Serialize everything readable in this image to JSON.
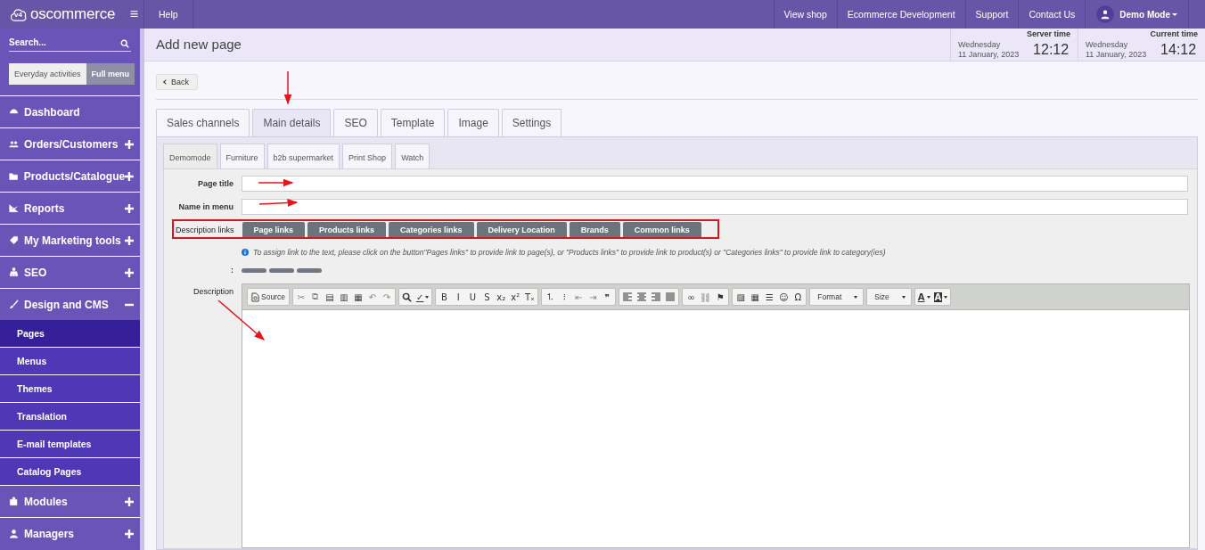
{
  "topbar": {
    "logo": "oscommerce",
    "logo_badge": "v4",
    "menu_glyph": "≡",
    "left_links": [
      "Help"
    ],
    "right_links": [
      "View shop",
      "Ecommerce Development",
      "Support",
      "Contact Us"
    ],
    "user": "Demo Mode"
  },
  "sidebar": {
    "search_placeholder": "Search...",
    "modes": [
      {
        "label": "Everyday activities",
        "selected": false
      },
      {
        "label": "Full menu",
        "selected": true
      }
    ],
    "items": [
      {
        "label": "Dashboard"
      },
      {
        "label": "Orders/Customers",
        "expanded": false
      },
      {
        "label": "Products/Catalogue",
        "expanded": false
      },
      {
        "label": "Reports",
        "expanded": false
      },
      {
        "label": "My Marketing tools",
        "expanded": false
      },
      {
        "label": "SEO",
        "expanded": false
      },
      {
        "label": "Design and CMS",
        "expanded": true,
        "children": [
          {
            "label": "Pages",
            "selected": true
          },
          {
            "label": "Menus",
            "selected": false
          },
          {
            "label": "Themes",
            "selected": false
          },
          {
            "label": "Translation",
            "selected": false
          },
          {
            "label": "E-mail templates",
            "selected": false
          },
          {
            "label": "Catalog Pages",
            "selected": false
          }
        ]
      },
      {
        "label": "Modules",
        "expanded": false
      },
      {
        "label": "Managers",
        "expanded": false
      }
    ]
  },
  "header": {
    "title": "Add new page",
    "clocks": [
      {
        "label": "Server time",
        "day": "Wednesday",
        "date": "11 January, 2023",
        "time": "12:12"
      },
      {
        "label": "Current time",
        "day": "Wednesday",
        "date": "11 January, 2023",
        "time": "14:12"
      }
    ]
  },
  "back_button": "Back",
  "tabs": [
    {
      "label": "Sales channels",
      "selected": false
    },
    {
      "label": "Main details",
      "selected": true
    },
    {
      "label": "SEO",
      "selected": false
    },
    {
      "label": "Template",
      "selected": false
    },
    {
      "label": "Image",
      "selected": false
    },
    {
      "label": "Settings",
      "selected": false
    }
  ],
  "store_tabs": [
    {
      "label": "Demomode",
      "selected": true
    },
    {
      "label": "Furniture",
      "selected": false
    },
    {
      "label": "b2b supermarket",
      "selected": false
    },
    {
      "label": "Print Shop",
      "selected": false
    },
    {
      "label": "Watch",
      "selected": false
    }
  ],
  "form": {
    "page_title_label": "Page title",
    "name_in_menu_label": "Name in menu",
    "links_label": "Description links",
    "link_buttons": [
      "Page links",
      "Products links",
      "Categories links",
      "Delivery Location",
      "Brands",
      "Common links"
    ],
    "info": "To assign link to the text, please click on the button\"Pages links\" to provide link to page(s), or \"Products links\" to provide link to product(s) or \"Categories links\" to provide link to category(ies)",
    "colon_label": ":",
    "description_label": "Description"
  },
  "toolbar": [
    [
      {
        "kind": "source",
        "text": "Source",
        "disabled": false
      }
    ],
    [
      {
        "kind": "glyph",
        "text": "✂",
        "disabled": true
      },
      {
        "kind": "glyph",
        "text": "⧉",
        "disabled": true
      },
      {
        "kind": "glyph",
        "text": "▤",
        "disabled": false
      },
      {
        "kind": "glyph",
        "text": "▥",
        "disabled": false
      },
      {
        "kind": "glyph",
        "text": "▦",
        "disabled": false
      },
      {
        "kind": "glyph",
        "text": "↶",
        "disabled": true
      },
      {
        "kind": "glyph",
        "text": "↷",
        "disabled": true
      }
    ],
    [
      {
        "kind": "search",
        "disabled": false
      },
      {
        "kind": "menu-glyph",
        "text": "✓",
        "disabled": false
      }
    ],
    [
      {
        "kind": "glyph",
        "text": "B",
        "disabled": false
      },
      {
        "kind": "glyph",
        "text": "I",
        "disabled": false
      },
      {
        "kind": "glyph",
        "text": "U",
        "disabled": false
      },
      {
        "kind": "glyph",
        "text": "S",
        "disabled": false
      },
      {
        "kind": "glyph",
        "text": "x₂",
        "disabled": false
      },
      {
        "kind": "glyph",
        "text": "x²",
        "disabled": false
      },
      {
        "kind": "glyph",
        "text": "Tₓ",
        "disabled": false
      }
    ],
    [
      {
        "kind": "glyph",
        "text": "⒈",
        "disabled": false
      },
      {
        "kind": "glyph",
        "text": "⁝",
        "disabled": false
      },
      {
        "kind": "glyph",
        "text": "⇤",
        "disabled": true
      },
      {
        "kind": "glyph",
        "text": "⇥",
        "disabled": true
      },
      {
        "kind": "glyph",
        "text": "❞",
        "disabled": false
      }
    ],
    [
      {
        "kind": "align-left",
        "disabled": false
      },
      {
        "kind": "align-center",
        "disabled": false
      },
      {
        "kind": "align-right",
        "disabled": false
      },
      {
        "kind": "align-justify",
        "disabled": false
      }
    ],
    [
      {
        "kind": "glyph",
        "text": "∞",
        "disabled": false
      },
      {
        "kind": "glyph",
        "text": "⛓",
        "disabled": true
      },
      {
        "kind": "glyph",
        "text": "⚑",
        "disabled": false
      }
    ],
    [
      {
        "kind": "glyph",
        "text": "▨",
        "disabled": false
      },
      {
        "kind": "glyph",
        "text": "▦",
        "disabled": false
      },
      {
        "kind": "glyph",
        "text": "☰",
        "disabled": false
      },
      {
        "kind": "glyph",
        "text": "☺",
        "disabled": false
      },
      {
        "kind": "glyph",
        "text": "Ω",
        "disabled": false
      }
    ],
    [
      {
        "kind": "dropdown",
        "text": "Format",
        "disabled": false
      }
    ],
    [
      {
        "kind": "dropdown",
        "text": "Size",
        "disabled": false
      }
    ],
    [
      {
        "kind": "menu-glyph",
        "text": "A",
        "disabled": false
      },
      {
        "kind": "menu-glyph-inverse",
        "text": "A",
        "disabled": false
      }
    ]
  ]
}
